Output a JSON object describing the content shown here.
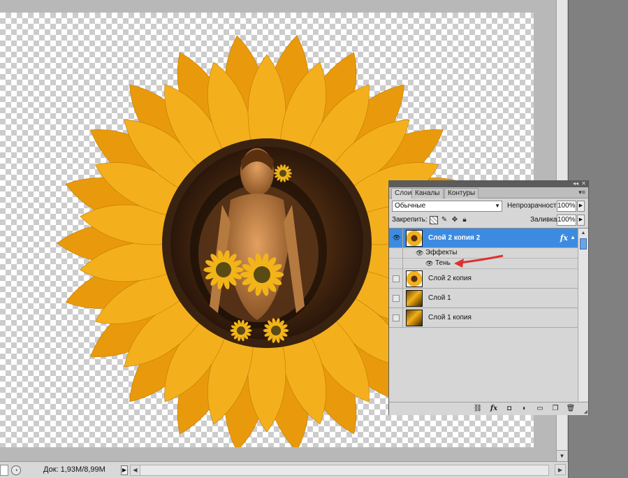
{
  "status_bar": {
    "zoom": "",
    "doc_info": "Док: 1,93M/8,99M",
    "arrow": "▶"
  },
  "layers_panel": {
    "tabs": [
      {
        "label": "Слои",
        "active": true
      },
      {
        "label": "Каналы",
        "active": false
      },
      {
        "label": "Контуры",
        "active": false
      }
    ],
    "blend_mode": "Обычные",
    "opacity_label": "Непрозрачность:",
    "opacity_value": "100%",
    "lock_label": "Закрепить:",
    "fill_label": "Заливка:",
    "fill_value": "100%",
    "layers": [
      {
        "name": "Слой 2 копия 2",
        "selected": true,
        "visible": true,
        "thumb": "sunflower",
        "fx": "fx"
      },
      {
        "name": "Слой 2 копия",
        "selected": false,
        "visible": false,
        "thumb": "sunflower"
      },
      {
        "name": "Слой 1",
        "selected": false,
        "visible": false,
        "thumb": "gradient"
      },
      {
        "name": "Слой 1 копия",
        "selected": false,
        "visible": false,
        "thumb": "gradient"
      }
    ],
    "effects_label": "Эффекты",
    "effect_name": "Тень"
  },
  "icons": {
    "eye": "eye-icon",
    "link": "link-layers-icon",
    "fx": "layer-style-icon",
    "mask": "add-mask-icon",
    "adjustment": "adjustment-layer-icon",
    "group": "new-group-icon",
    "new_layer": "new-layer-icon",
    "trash": "delete-layer-icon"
  },
  "colors": {
    "selection": "#3d8be0",
    "annotation_arrow": "#e03030",
    "petal": "#f2ad1a"
  }
}
